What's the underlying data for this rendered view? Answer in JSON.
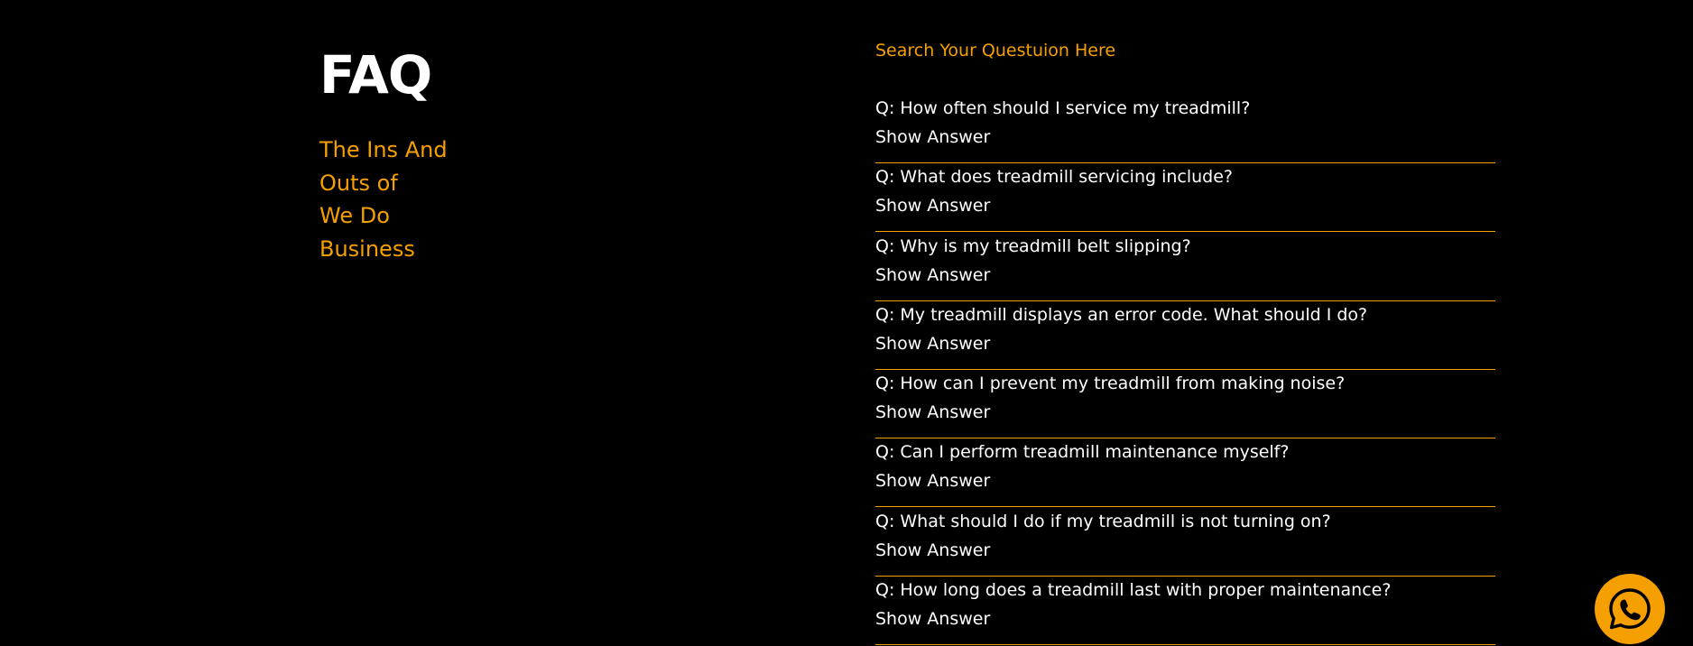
{
  "header": {
    "title": "FAQ",
    "tagline_lines": [
      "The Ins And",
      "Outs of",
      "We Do",
      "Business"
    ]
  },
  "search": {
    "label": "Search Your Questuion Here"
  },
  "faq": {
    "items": [
      {
        "question": "Q: How often should I service my treadmill?",
        "toggle_label": "Show Answer"
      },
      {
        "question": "Q: What does treadmill servicing include?",
        "toggle_label": "Show Answer"
      },
      {
        "question": "Q: Why is my treadmill belt slipping?",
        "toggle_label": "Show Answer"
      },
      {
        "question": "Q: My treadmill displays an error code. What should I do?",
        "toggle_label": "Show Answer"
      },
      {
        "question": "Q: How can I prevent my treadmill from making noise?",
        "toggle_label": "Show Answer"
      },
      {
        "question": "Q: Can I perform treadmill maintenance myself?",
        "toggle_label": "Show Answer"
      },
      {
        "question": "Q: What should I do if my treadmill is not turning on?",
        "toggle_label": "Show Answer"
      },
      {
        "question": "Q: How long does a treadmill last with proper maintenance?",
        "toggle_label": "Show Answer"
      }
    ]
  },
  "chat_widget": {
    "icon": "whatsapp-icon"
  },
  "colors": {
    "background": "#000000",
    "accent": "#f5a000",
    "text": "#ffffff"
  }
}
